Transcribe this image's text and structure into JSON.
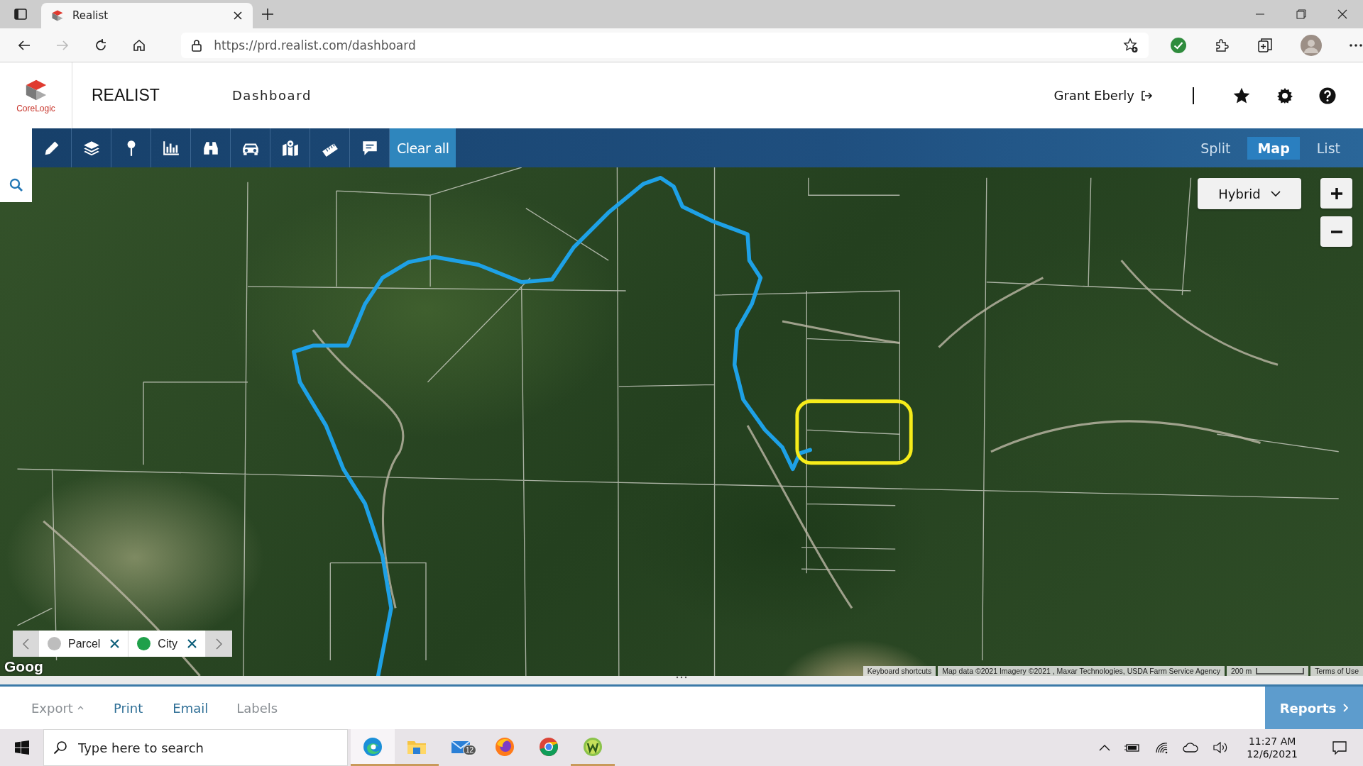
{
  "browser": {
    "tab_title": "Realist",
    "url": "https://prd.realist.com/dashboard"
  },
  "header": {
    "logo_text": "CoreLogic",
    "app_name": "REALIST",
    "page": "Dashboard",
    "user": "Grant Eberly"
  },
  "toolbar": {
    "clear_label": "Clear all",
    "views": [
      {
        "label": "Split",
        "selected": false
      },
      {
        "label": "Map",
        "selected": true
      },
      {
        "label": "List",
        "selected": false
      }
    ]
  },
  "map": {
    "map_type": "Hybrid",
    "logo": "Goog",
    "legend": [
      {
        "label": "Parcel",
        "color": "#bdbdbd"
      },
      {
        "label": "City",
        "color": "#1fa04a"
      }
    ],
    "attribution": [
      {
        "kind": "text",
        "text": "Keyboard shortcuts"
      },
      {
        "kind": "text",
        "text": "Map data ©2021 Imagery ©2021 , Maxar Technologies, USDA Farm Service Agency"
      },
      {
        "kind": "scale",
        "text": "200 m"
      },
      {
        "kind": "text",
        "text": "Terms of Use"
      }
    ]
  },
  "actions": [
    {
      "label": "Export",
      "kind": "menu",
      "disabled": true
    },
    {
      "label": "Print",
      "kind": "plain",
      "disabled": false
    },
    {
      "label": "Email",
      "kind": "plain",
      "disabled": false
    },
    {
      "label": "Labels",
      "kind": "plain",
      "disabled": true
    }
  ],
  "reports_label": "Reports",
  "taskbar": {
    "search_placeholder": "Type here to search",
    "time": "11:27 AM",
    "date": "12/6/2021",
    "apps": [
      {
        "kind": "edge",
        "running": true,
        "selected": true
      },
      {
        "kind": "folder",
        "running": true,
        "selected": false
      },
      {
        "kind": "mail",
        "running": false,
        "selected": false,
        "badge": "12"
      },
      {
        "kind": "firefox",
        "running": false,
        "selected": false
      },
      {
        "kind": "chrome",
        "running": false,
        "selected": false
      },
      {
        "kind": "w",
        "running": true,
        "selected": false
      }
    ]
  }
}
